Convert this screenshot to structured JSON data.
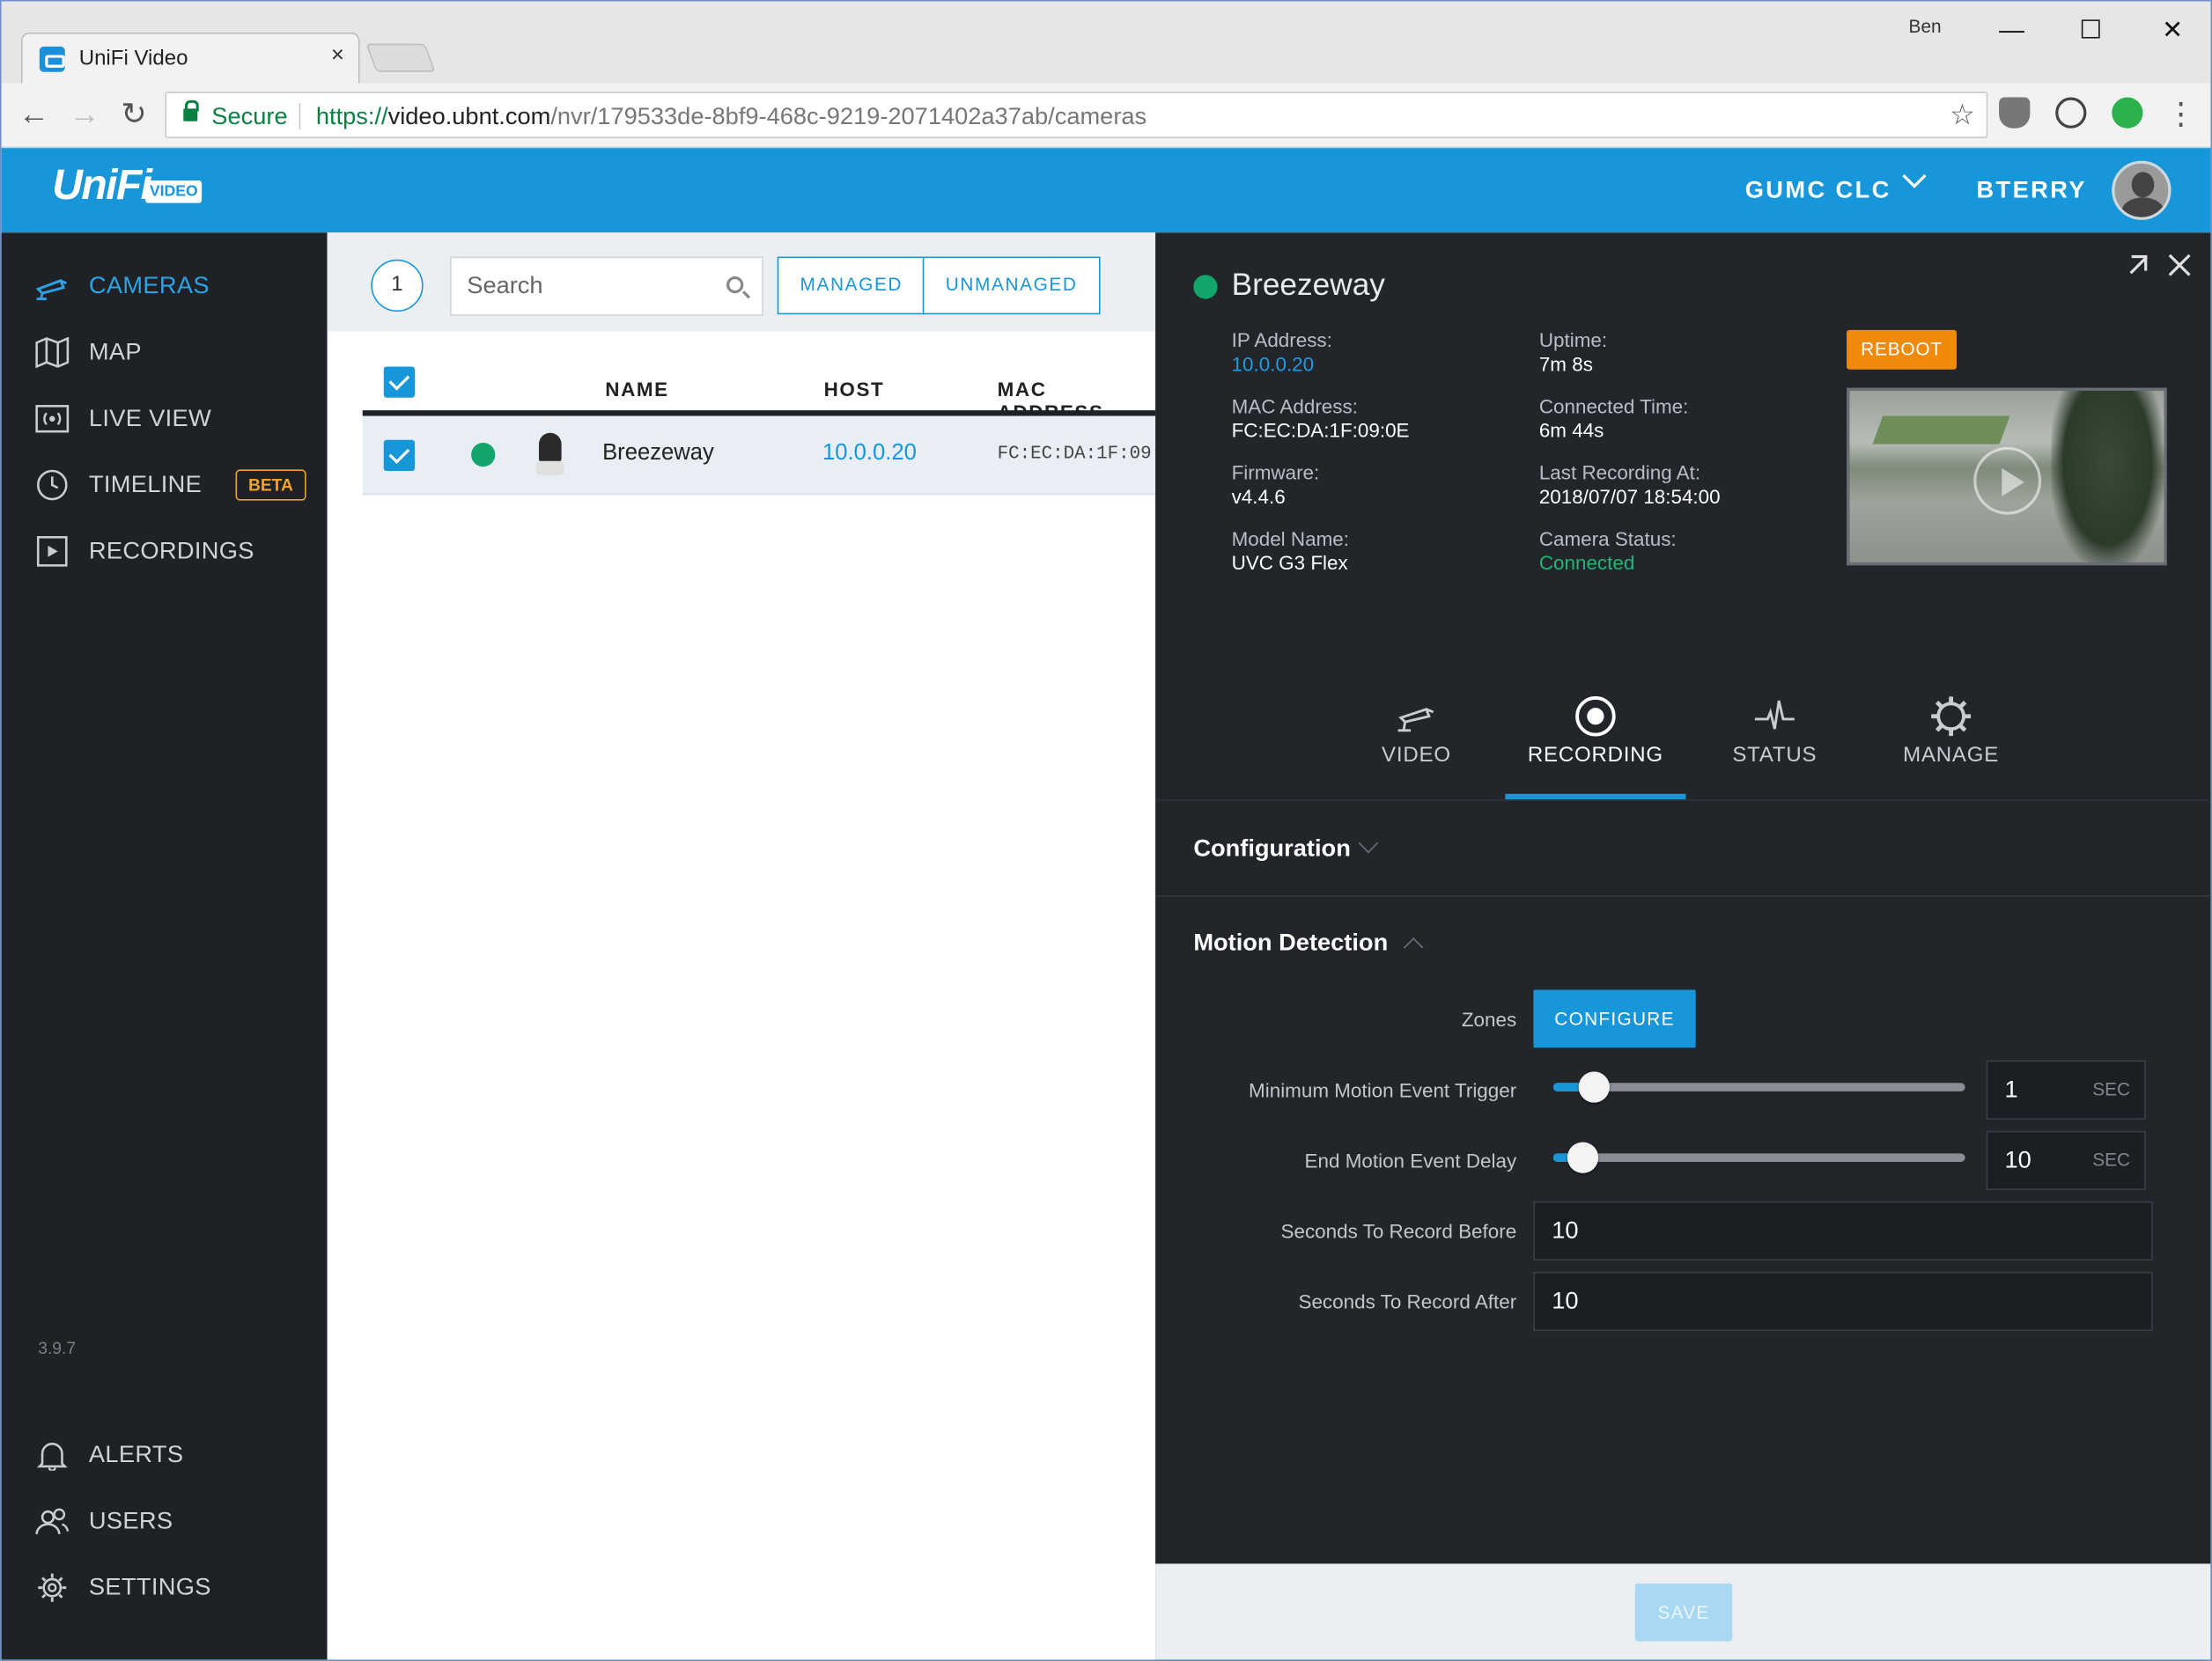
{
  "browser": {
    "tab_title": "UniFi Video",
    "tab_close": "×",
    "window_user": "Ben",
    "secure_label": "Secure",
    "url_scheme": "https://",
    "url_host": "video.ubnt.com",
    "url_path": "/nvr/179533de-8bf9-468c-9219-2071402a37ab/cameras",
    "win_minimize": "—",
    "win_maximize": "☐",
    "win_close": "✕",
    "back": "←",
    "forward": "→",
    "reload": "↻",
    "bookmark_star": "☆",
    "menu_dots": "⋮"
  },
  "header": {
    "logo_text": "UniFi",
    "logo_badge": "VIDEO",
    "site_name": "GUMC CLC",
    "user_name": "BTERRY",
    "brand_color": "#1797d9"
  },
  "sidebar": {
    "items": [
      {
        "label": "CAMERAS",
        "icon": "camera-icon",
        "active": true
      },
      {
        "label": "MAP",
        "icon": "map-icon"
      },
      {
        "label": "LIVE VIEW",
        "icon": "live-view-icon"
      },
      {
        "label": "TIMELINE",
        "icon": "clock-icon",
        "badge": "BETA"
      },
      {
        "label": "RECORDINGS",
        "icon": "play-square-icon"
      }
    ],
    "version": "3.9.7",
    "bottom_items": [
      {
        "label": "ALERTS",
        "icon": "bell-icon"
      },
      {
        "label": "USERS",
        "icon": "users-icon"
      },
      {
        "label": "SETTINGS",
        "icon": "gear-icon"
      }
    ]
  },
  "camera_list": {
    "count": "1",
    "search_placeholder": "Search",
    "filter_managed": "MANAGED",
    "filter_unmanaged": "UNMANAGED",
    "columns": [
      "NAME",
      "HOST",
      "MAC ADDRESS"
    ],
    "rows": [
      {
        "name": "Breezeway",
        "host": "10.0.0.20",
        "mac": "FC:EC:DA:1F:09",
        "checked": true,
        "status": "online"
      }
    ]
  },
  "detail": {
    "camera_name": "Breezeway",
    "reboot_label": "REBOOT",
    "info": {
      "ip_label": "IP Address:",
      "ip_value": "10.0.0.20",
      "mac_label": "MAC Address:",
      "mac_value": "FC:EC:DA:1F:09:0E",
      "firmware_label": "Firmware:",
      "firmware_value": "v4.4.6",
      "model_label": "Model Name:",
      "model_value": "UVC G3 Flex",
      "uptime_label": "Uptime:",
      "uptime_value": "7m 8s",
      "connected_label": "Connected Time:",
      "connected_value": "6m 44s",
      "last_rec_label": "Last Recording At:",
      "last_rec_value": "2018/07/07 18:54:00",
      "status_label": "Camera Status:",
      "status_value": "Connected"
    },
    "tabs": [
      {
        "label": "VIDEO",
        "icon": "camera-icon"
      },
      {
        "label": "RECORDING",
        "icon": "record-icon",
        "active": true
      },
      {
        "label": "STATUS",
        "icon": "pulse-icon"
      },
      {
        "label": "MANAGE",
        "icon": "gear-icon"
      }
    ],
    "configuration_heading": "Configuration",
    "motion_heading": "Motion Detection",
    "zones_label": "Zones",
    "configure_label": "CONFIGURE",
    "min_trigger_label": "Minimum Motion Event Trigger",
    "min_trigger_value": "1",
    "min_trigger_unit": "SEC",
    "end_delay_label": "End Motion Event Delay",
    "end_delay_value": "10",
    "end_delay_unit": "SEC",
    "record_before_label": "Seconds To Record Before",
    "record_before_value": "10",
    "record_after_label": "Seconds To Record After",
    "record_after_value": "10",
    "save_label": "SAVE"
  }
}
